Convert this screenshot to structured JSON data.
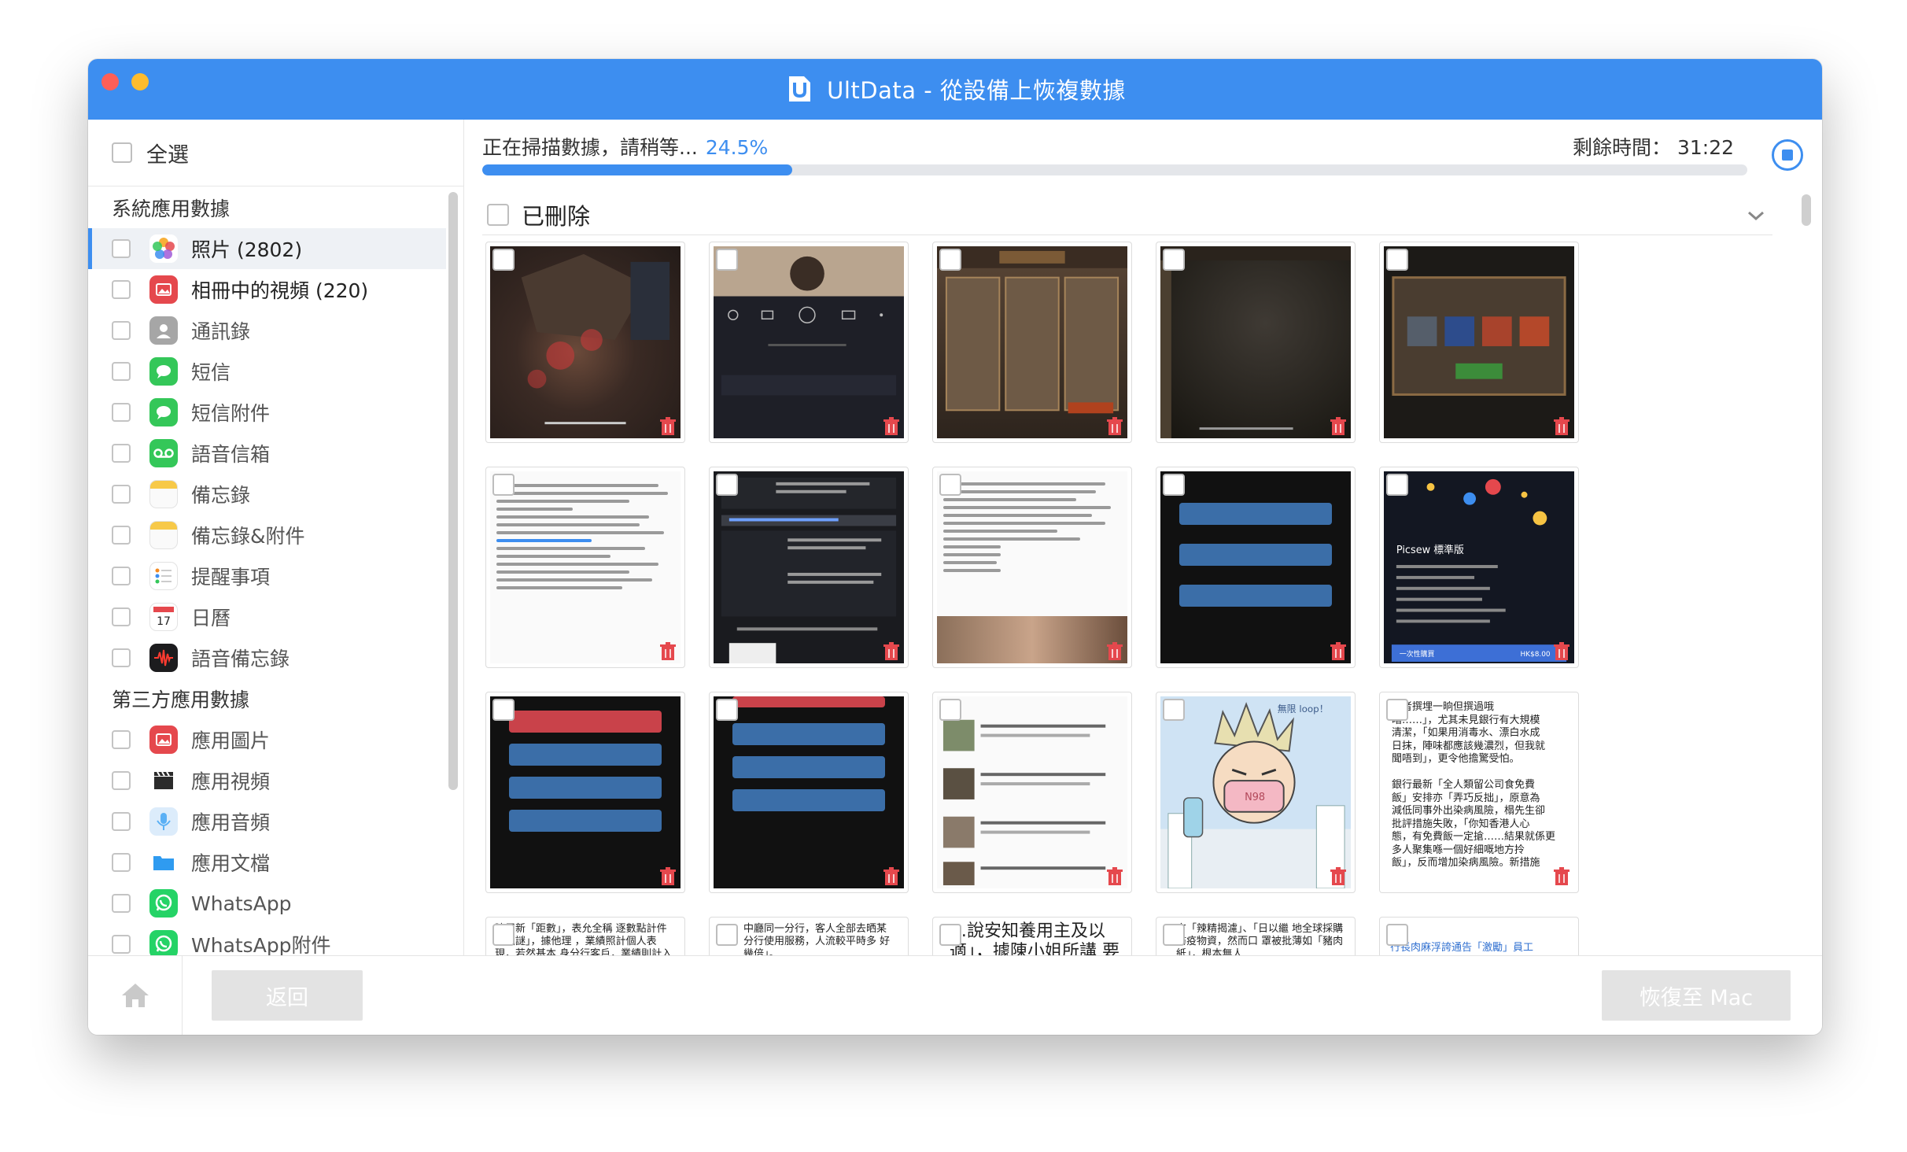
{
  "window": {
    "title": "UltData - 從設備上恢複數據"
  },
  "sidebar": {
    "select_all_label": "全選",
    "sections": [
      {
        "heading": "系統應用數據",
        "items": [
          {
            "label": "照片 (2802)",
            "icon": "photos-icon",
            "color": "#ffffff",
            "active": true
          },
          {
            "label": "相冊中的視頻 (220)",
            "icon": "album-video-icon",
            "color": "#e5484d"
          },
          {
            "label": "通訊錄",
            "icon": "contacts-icon",
            "color": "#a6a6a6"
          },
          {
            "label": "短信",
            "icon": "messages-icon",
            "color": "#34c759"
          },
          {
            "label": "短信附件",
            "icon": "message-attachments-icon",
            "color": "#34c759"
          },
          {
            "label": "語音信箱",
            "icon": "voicemail-icon",
            "color": "#34c759"
          },
          {
            "label": "備忘錄",
            "icon": "notes-icon",
            "color": "#f7c948"
          },
          {
            "label": "備忘錄&附件",
            "icon": "notes-attachments-icon",
            "color": "#f7c948"
          },
          {
            "label": "提醒事項",
            "icon": "reminders-icon",
            "color": "#ffffff"
          },
          {
            "label": "日曆",
            "icon": "calendar-icon",
            "color": "#ffffff"
          },
          {
            "label": "語音備忘錄",
            "icon": "voice-memos-icon",
            "color": "#1c1c1e"
          }
        ]
      },
      {
        "heading": "第三方應用數據",
        "items": [
          {
            "label": "應用圖片",
            "icon": "app-photos-icon",
            "color": "#e5484d"
          },
          {
            "label": "應用視頻",
            "icon": "app-videos-icon",
            "color": "#2b2b2b"
          },
          {
            "label": "應用音頻",
            "icon": "app-audio-icon",
            "color": "#5ab0f5"
          },
          {
            "label": "應用文檔",
            "icon": "app-docs-icon",
            "color": "#2f9bf0"
          },
          {
            "label": "WhatsApp",
            "icon": "whatsapp-icon",
            "color": "#25d366"
          },
          {
            "label": "WhatsApp附件",
            "icon": "whatsapp-attachments-icon",
            "color": "#25d366"
          }
        ]
      }
    ]
  },
  "scan": {
    "status_text": "正在掃描數據，請稍等...",
    "percent_text": "24.5%",
    "progress": 0.245,
    "remaining_label": "剩餘時間：",
    "remaining_value": "31:22"
  },
  "filter": {
    "deleted_label": "已刪除"
  },
  "thumbnails": {
    "row3_col5_lines": [
      "或者撰埋一晌但撰過哦",
      "暗……」，尤其未見銀行有大規模",
      "清潔，「如果用消毒水、漂白水成",
      "日抹，陣味都應該幾濃烈，但我就",
      "聞唔到」，更令他擔驚受怕。",
      "",
      "銀行最新「全人類留公司食免費",
      "飯」安排亦「弄巧反拙」，原意為",
      "減低同事外出染病風險，榻先生卻",
      "批評措施失敗，「你知香港人心",
      "態，有免費飯一定搶……結果就係更",
      "多人聚集喺一個好細嘅地方拎",
      "飯」，反而增加染病風險。新措施"
    ],
    "row4_texts": [
      "曉用新「距數」，表允全稱 逐數點計件係個謎」，據他理 ，業績照計個人表現，若然基本 身分行客戶，業績則計入雙屬的",
      "中廳同一分行，客人全部去晒某 分行使用服務，人流較平時多 好幾倍」。",
      "…說安知養用主及以 適」，據陳小姐所講 要求分行同事自行清",
      "方「辣精揭濾」、「日以繼 地全球採購防疫物資，然而口 罩被批薄如「豬肉紙」，根本無人",
      "行長肉麻浮誇通告「激勵」員工"
    ],
    "mask_label": "N98",
    "comic_caption": "無限 loop！",
    "picsew_title": "Picsew 標準版",
    "picsew_price": "HK$8.00",
    "picsew_buy": "一次性購買"
  },
  "footer": {
    "back_label": "返回",
    "recover_label": "恢復至 Mac"
  },
  "colors": {
    "accent": "#3d8ef0",
    "disabled_button": "#e3e3e3",
    "trash": "#e5484d"
  }
}
